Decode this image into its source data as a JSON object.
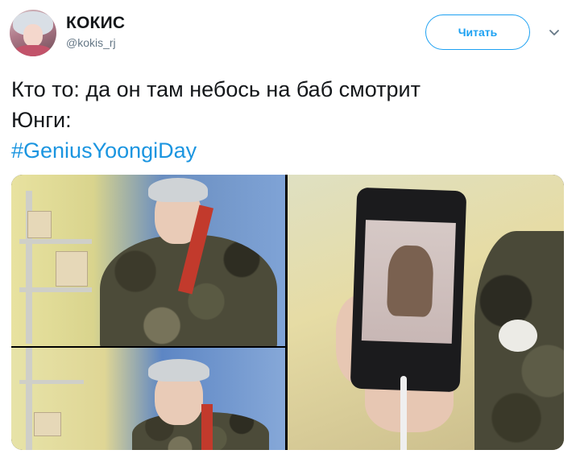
{
  "author": {
    "display_name": "КОКИС",
    "handle": "@kokis_rj"
  },
  "actions": {
    "follow_label": "Читать",
    "menu_icon": "chevron-down-icon"
  },
  "tweet": {
    "line1": "Кто то: да он там небось на баб смотрит",
    "line2": "Юнги:",
    "hashtag": "#GeniusYoongiDay"
  },
  "colors": {
    "accent": "#1da1f2",
    "hashtag": "#1b95e0",
    "text": "#14171a",
    "muted": "#657786"
  }
}
